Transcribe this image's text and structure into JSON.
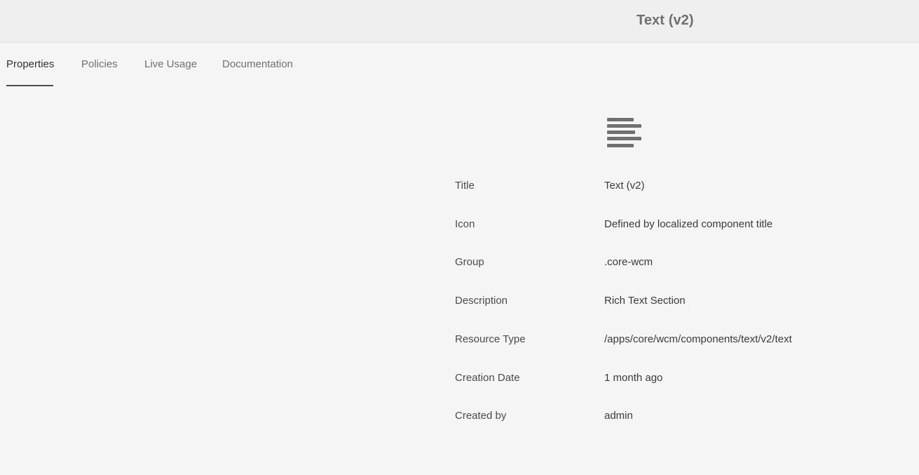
{
  "header": {
    "title": "Text (v2)"
  },
  "tabs": [
    {
      "label": "Properties",
      "active": true
    },
    {
      "label": "Policies",
      "active": false
    },
    {
      "label": "Live Usage",
      "active": false
    },
    {
      "label": "Documentation",
      "active": false
    }
  ],
  "component_icon": "text-align-left-icon",
  "properties": [
    {
      "label": "Title",
      "value": "Text (v2)"
    },
    {
      "label": "Icon",
      "value": "Defined by localized component title"
    },
    {
      "label": "Group",
      "value": ".core-wcm"
    },
    {
      "label": "Description",
      "value": "Rich Text Section"
    },
    {
      "label": "Resource Type",
      "value": "/apps/core/wcm/components/text/v2/text"
    },
    {
      "label": "Creation Date",
      "value": "1 month ago"
    },
    {
      "label": "Created by",
      "value": "admin"
    }
  ]
}
